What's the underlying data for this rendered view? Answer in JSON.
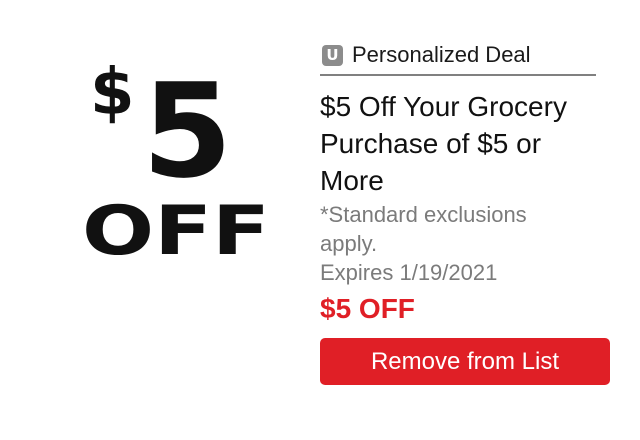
{
  "coupon_image": {
    "amount": "$5",
    "label": "OFF"
  },
  "deal_tag": {
    "badge": "U",
    "label": "Personalized Deal"
  },
  "offer": {
    "title": "$5 Off Your Grocery Purchase of $5 or More",
    "exclusions": "*Standard exclusions apply.",
    "expires": "Expires 1/19/2021",
    "discount": "$5 OFF"
  },
  "actions": {
    "remove_label": "Remove from List"
  },
  "colors": {
    "accent": "#e01f26",
    "muted_text": "#7b7b7b",
    "badge": "#8c8c8c"
  }
}
